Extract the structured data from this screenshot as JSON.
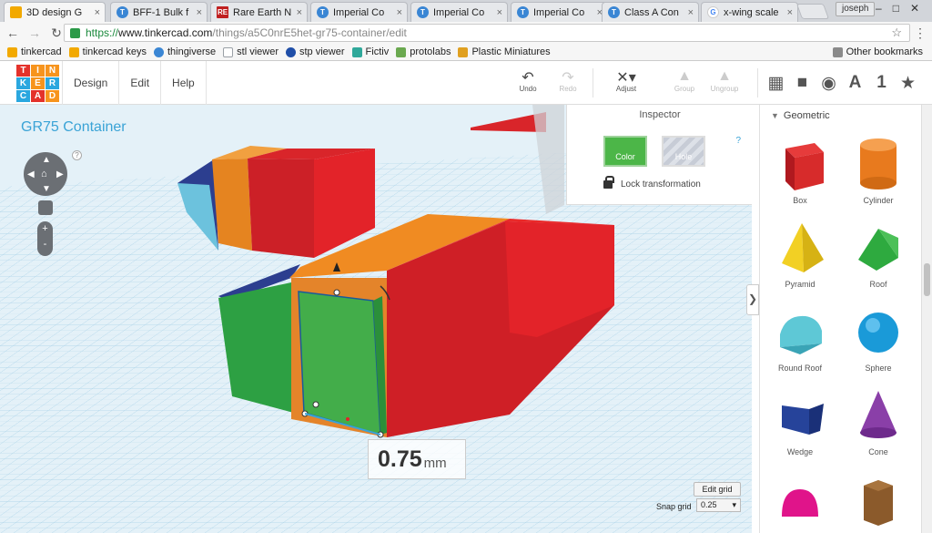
{
  "browser": {
    "tabs": [
      {
        "title": "3D design G",
        "icon_color": "#f2a900",
        "icon_text": "",
        "active": true
      },
      {
        "title": "BFF-1 Bulk f",
        "icon_color": "#3a86d4",
        "icon_text": "T",
        "active": false
      },
      {
        "title": "Rare Earth N",
        "icon_color": "#c02020",
        "icon_text": "RE",
        "active": false
      },
      {
        "title": "Imperial Co",
        "icon_color": "#3a86d4",
        "icon_text": "T",
        "active": false
      },
      {
        "title": "Imperial Co",
        "icon_color": "#3a86d4",
        "icon_text": "T",
        "active": false
      },
      {
        "title": "Imperial Co",
        "icon_color": "#3a86d4",
        "icon_text": "T",
        "active": false
      },
      {
        "title": "Class A Con",
        "icon_color": "#3a86d4",
        "icon_text": "T",
        "active": false
      },
      {
        "title": "x-wing scale",
        "icon_color": "#4285f4",
        "icon_text": "G",
        "active": false
      }
    ],
    "profile_name": "joseph",
    "url": {
      "scheme": "https://",
      "host": "www.tinkercad.com",
      "path": "/things/a5C0nrE5het-gr75-container/edit"
    },
    "bookmarks": [
      {
        "label": "tinkercad",
        "color": "#f2a900"
      },
      {
        "label": "tinkercad keys",
        "color": "#f2a900"
      },
      {
        "label": "thingiverse",
        "color": "#3a86d4"
      },
      {
        "label": "stl viewer",
        "color": "#9aa0a6"
      },
      {
        "label": "stp viewer",
        "color": "#1f4ea8"
      },
      {
        "label": "Fictiv",
        "color": "#2fa89a"
      },
      {
        "label": "protolabs",
        "color": "#6aa84f"
      },
      {
        "label": "Plastic Miniatures",
        "color": "#e0a020"
      }
    ],
    "other_bookmarks": "Other bookmarks"
  },
  "app": {
    "logo_letters": [
      "T",
      "I",
      "N",
      "K",
      "E",
      "R",
      "C",
      "A",
      "D"
    ],
    "logo_colors": [
      "#e4322b",
      "#f7941d",
      "#f7941d",
      "#2aa7df",
      "#f7941d",
      "#2aa7df",
      "#2aa7df",
      "#e4322b",
      "#f7941d"
    ],
    "menu": [
      "Design",
      "Edit",
      "Help"
    ],
    "tools": {
      "undo": "Undo",
      "redo": "Redo",
      "adjust": "Adjust",
      "group": "Group",
      "ungroup": "Ungroup"
    },
    "right_tools": [
      "grid-icon",
      "box-icon",
      "sphere-icon",
      "text-icon",
      "number-icon",
      "favorites-icon"
    ],
    "right_tool_glyphs": [
      "▦",
      "■",
      "◉",
      "A",
      "1",
      "★"
    ]
  },
  "workplane": {
    "design_title": "GR75 Container",
    "help_glyph": "?",
    "inspector": {
      "title": "Inspector",
      "help": "?",
      "color_label": "Color",
      "hole_label": "Hole",
      "lock_label": "Lock transformation",
      "color_value": "#4cb648"
    },
    "measurement": {
      "value": "0.75",
      "unit": "mm"
    },
    "edit_grid": "Edit grid",
    "snap_grid_label": "Snap grid",
    "snap_grid_value": "0.25",
    "zoom_in": "+",
    "zoom_out": "-"
  },
  "shapes_panel": {
    "category": "Geometric",
    "items": [
      {
        "label": "Box",
        "color": "#d72b2b"
      },
      {
        "label": "Cylinder",
        "color": "#e87a1e"
      },
      {
        "label": "Pyramid",
        "color": "#f2d024"
      },
      {
        "label": "Roof",
        "color": "#2eaa3f"
      },
      {
        "label": "Round Roof",
        "color": "#5ec8d6"
      },
      {
        "label": "Sphere",
        "color": "#1a9ad8"
      },
      {
        "label": "Wedge",
        "color": "#26439a"
      },
      {
        "label": "Cone",
        "color": "#8a3fa8"
      },
      {
        "label": "",
        "color": "#e0148a"
      },
      {
        "label": "",
        "color": "#8b5a2b"
      }
    ]
  }
}
